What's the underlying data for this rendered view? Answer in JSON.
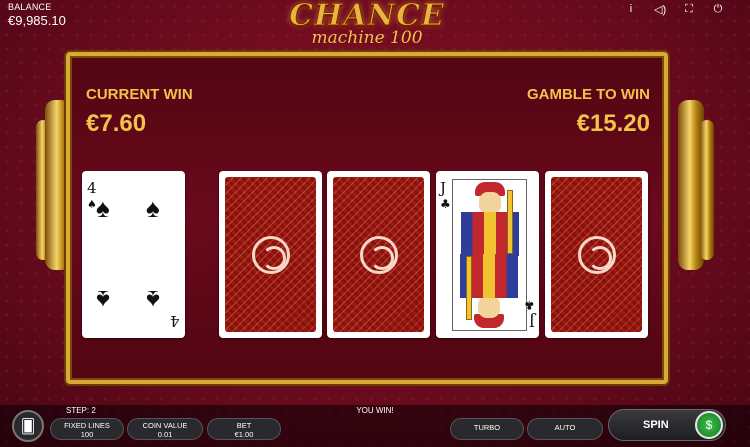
{
  "top": {
    "balance_label": "BALANCE",
    "balance_value": "€9,985.10",
    "icons": [
      "info-icon",
      "sound-icon",
      "fullscreen-icon",
      "power-icon"
    ]
  },
  "logo": {
    "line1": "CHANCE",
    "line2": "machine 100"
  },
  "gamble": {
    "current_win_label": "CURRENT WIN",
    "current_win_value": "€7.60",
    "gamble_to_win_label": "GAMBLE TO WIN",
    "gamble_to_win_value": "€15.20"
  },
  "cards": [
    {
      "state": "face-up",
      "rank": "4",
      "suit": "♠"
    },
    {
      "state": "face-down"
    },
    {
      "state": "face-down"
    },
    {
      "state": "face-up",
      "rank": "J",
      "suit": "♣"
    },
    {
      "state": "face-down"
    }
  ],
  "bottom": {
    "step_label": "STEP: 2",
    "message": "YOU WIN!",
    "fixed_lines_label": "FIXED LINES",
    "fixed_lines_value": "100",
    "coin_value_label": "COIN VALUE",
    "coin_value_value": "0.01",
    "bet_label": "BET",
    "bet_value": "€1.00",
    "turbo_label": "TURBO",
    "auto_label": "AUTO",
    "spin_label": "SPIN"
  },
  "colors": {
    "gold": "#f2c24a",
    "background": "#6a0b1e",
    "spin_green": "#3fbf4a"
  }
}
